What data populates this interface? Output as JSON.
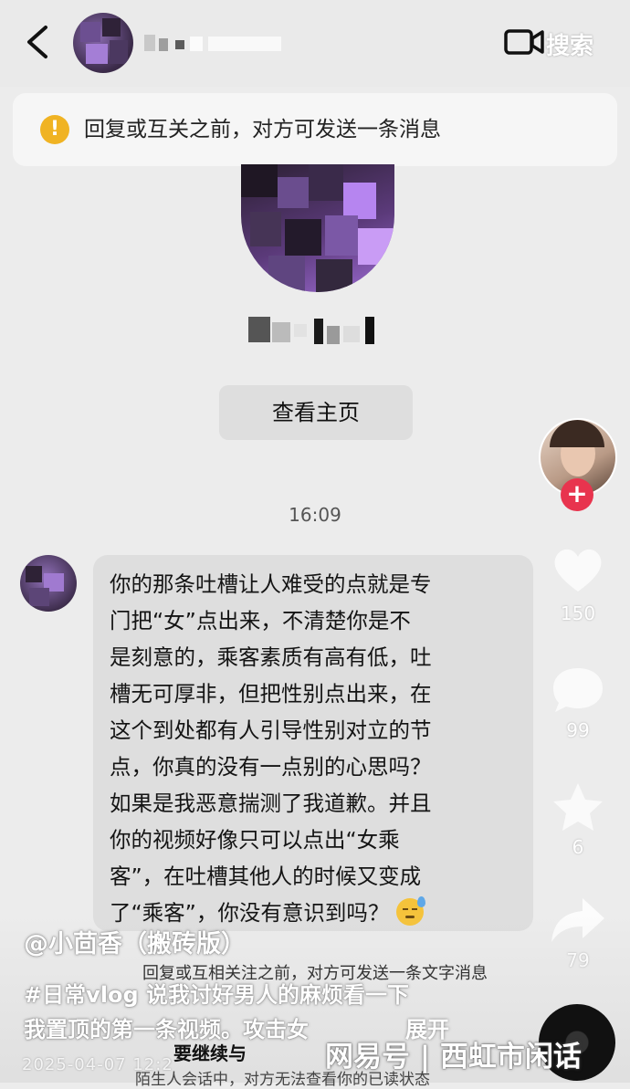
{
  "header": {
    "back_icon": "chevron-left-icon",
    "video_call_icon": "video-camera-icon",
    "search_label": "搜索"
  },
  "notice": {
    "icon": "warning-icon",
    "icon_glyph": "!",
    "text": "回复或互关之前，对方可发送一条消息"
  },
  "profile": {
    "view_home_label": "查看主页"
  },
  "chat": {
    "time": "16:09",
    "message_lines": [
      "你的那条吐槽让人难受的点就是专",
      "门把“女”点出来，不清楚你是不",
      "是刻意的，乘客素质有高有低，吐",
      "槽无可厚非，但把性别点出来，在",
      "这个到处都有人引导性别对立的节",
      "点，你真的没有一点别的心思吗？",
      "如果是我恶意揣测了我道歉。并且",
      "你的视频好像只可以点出“女乘",
      "客”，在吐槽其他人的时候又变成",
      "了“乘客”，你没有意识到吗？"
    ],
    "message_emoji": "downcast-face-with-sweat-emoji"
  },
  "video_overlay": {
    "follow_glyph": "+",
    "like_count": "150",
    "comment_count": "99",
    "favorite_count": "6",
    "share_count": "79",
    "author": "@小茴香（搬砖版）",
    "caption_line1": "#日常vlog 说我讨好男人的麻烦看一下",
    "caption_line2": "我置顶的第一条视频。攻击女",
    "expand_label": "展开",
    "date_partial": "2025-04-07 12:2",
    "footer_notice": "回复或互相关注之前，对方可发送一条文字消息",
    "continue_partial": "要继续与",
    "stranger_partial": "陌生人会话中，对方无法查看你的已读状态",
    "watermark": "网易号 | 西虹市闲话"
  },
  "colors": {
    "background": "#ececec",
    "bubble": "#dedede",
    "warning": "#f0b323",
    "follow": "#e8344e"
  }
}
